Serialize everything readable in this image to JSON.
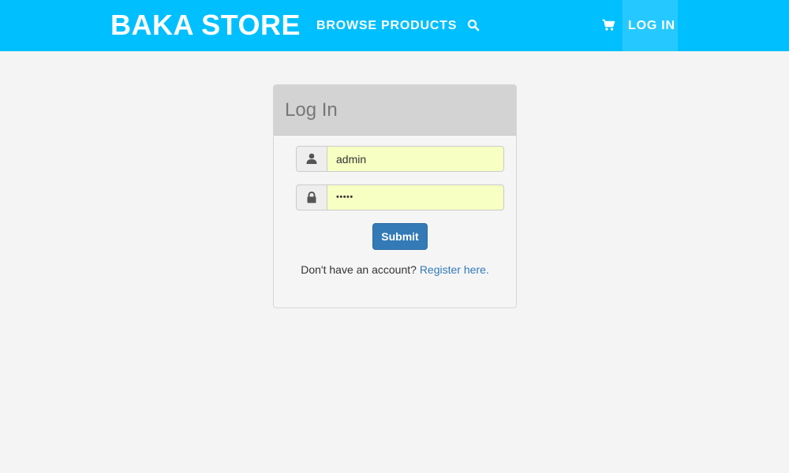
{
  "navbar": {
    "brand": "BAKA STORE",
    "browse_label": "BROWSE PRODUCTS",
    "search_icon": "search-icon",
    "cart_icon": "cart-icon",
    "login_label": "LOG IN",
    "bg_color": "#00bfff",
    "active_bg_color": "#26c9ff"
  },
  "login_panel": {
    "title": "Log In",
    "username": {
      "icon": "user-icon",
      "value": "admin"
    },
    "password": {
      "icon": "lock-icon",
      "value": "•••••"
    },
    "submit_label": "Submit",
    "register_prompt": "Don't have an account?",
    "register_link": "Register here."
  },
  "colors": {
    "page_bg": "#f4f4f4",
    "autofill_bg": "#f7ffc2",
    "primary_button": "#337ab7",
    "link": "#337ab7"
  }
}
